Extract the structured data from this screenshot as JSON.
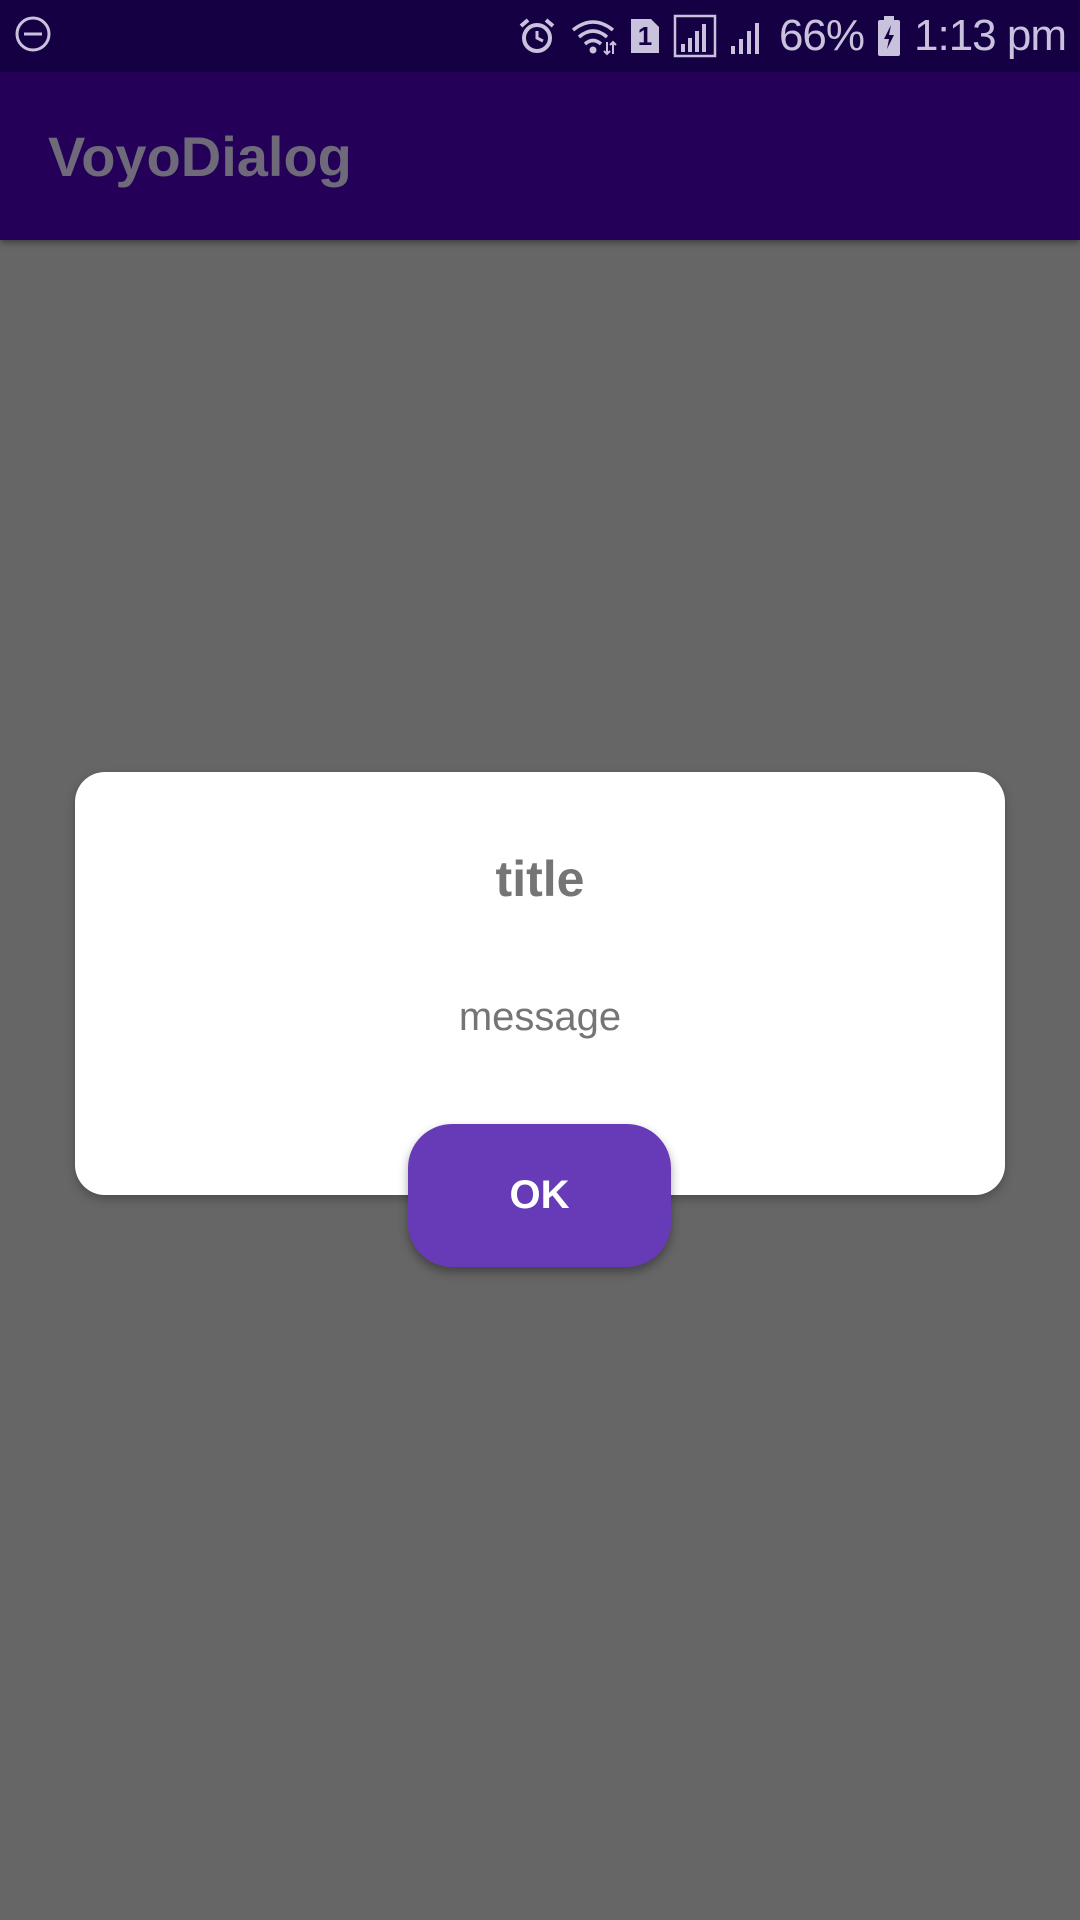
{
  "status_bar": {
    "battery": "66%",
    "time": "1:13 pm",
    "sim_slot": "1",
    "icons": [
      "do-not-disturb-icon",
      "alarm-icon",
      "wifi-icon",
      "sim-icon",
      "signal-icon",
      "signal-icon",
      "battery-charging-icon"
    ]
  },
  "app_bar": {
    "title": "VoyoDialog"
  },
  "dialog": {
    "title": "title",
    "message": "message",
    "ok_label": "OK"
  },
  "colors": {
    "status_bar": "#140043",
    "app_bar": "#240059",
    "scrim_background": "#666666",
    "dialog_background": "#ffffff",
    "button": "#673ab7",
    "dialog_text": "#757575"
  }
}
